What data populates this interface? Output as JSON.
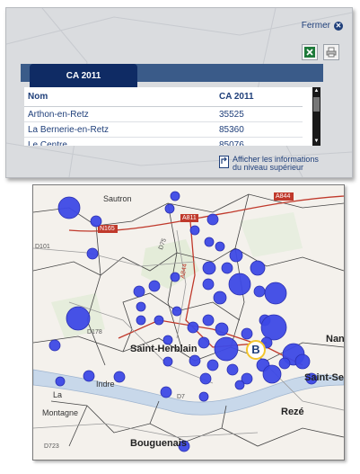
{
  "popup": {
    "close_label": "Fermer",
    "tab_label": "CA 2011",
    "table": {
      "headers": [
        "Nom",
        "CA 2011"
      ],
      "rows": [
        [
          "Arthon-en-Retz",
          "35525"
        ],
        [
          "La Bernerie-en-Retz",
          "85360"
        ],
        [
          "Le Centre",
          "85076"
        ]
      ]
    },
    "upper_level_link": {
      "line1": "Afficher les informations",
      "line2": "du niveau supérieur"
    },
    "colors": {
      "tab": "#0f2b64",
      "text": "#1f3f7a"
    }
  },
  "map": {
    "labels": {
      "sautron": "Sautron",
      "saint_herblain": "Saint-Herblain",
      "indre": "Indre",
      "la": "La",
      "montagne": "Montagne",
      "bouguenais": "Bouguenais",
      "reze": "Rezé",
      "nantes_partial": "Nan",
      "saint_se_partial": "Saint-Se",
      "road_a844": "A844",
      "road_a844_v": "A844",
      "road_n165": "N165",
      "road_d101": "D101",
      "road_d75": "D75",
      "road_d7": "D7",
      "road_d723": "D723",
      "road_d178": "D178",
      "road_a811": "A811",
      "logo": "B"
    },
    "bubble_color": "#3d49e6",
    "bubble_stroke": "#2a2fb0"
  }
}
